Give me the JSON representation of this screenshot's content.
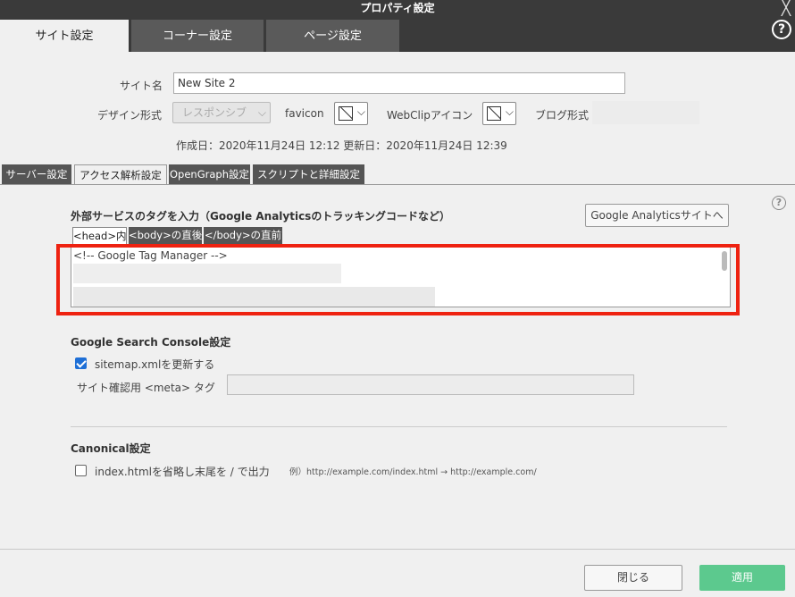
{
  "window": {
    "title": "プロパティ設定",
    "close_label": "╳"
  },
  "top_tabs": [
    {
      "label": "サイト設定"
    },
    {
      "label": "コーナー設定"
    },
    {
      "label": "ページ設定"
    }
  ],
  "site": {
    "name_label": "サイト名",
    "name_value": "New Site 2",
    "design_label": "デザイン形式",
    "design_value": "レスポンシブ",
    "favicon_label": "favicon",
    "webclip_label": "WebClipアイコン",
    "blog_label": "ブログ形式",
    "dates": "作成日：2020年11月24日 12:12 更新日：2020年11月24日 12:39"
  },
  "sub_tabs": [
    {
      "label": "サーバー設定"
    },
    {
      "label": "アクセス解析設定"
    },
    {
      "label": "OpenGraph設定"
    },
    {
      "label": "スクリプトと詳細設定"
    }
  ],
  "analytics": {
    "section_title": "外部サービスのタグを入力（Google Analyticsのトラッキングコードなど）",
    "ga_button": "Google Analyticsサイトへ",
    "tag_tabs": [
      {
        "label": "<head>内"
      },
      {
        "label": "<body>の直後"
      },
      {
        "label": "</body>の直前"
      }
    ],
    "textarea_line1": "<!-- Google Tag Manager -->"
  },
  "search_console": {
    "title": "Google Search Console設定",
    "sitemap_label": "sitemap.xmlを更新する",
    "sitemap_checked": true,
    "meta_label": "サイト確認用 <meta> タグ"
  },
  "canonical": {
    "title": "Canonical設定",
    "omit_label": "index.htmlを省略し末尾を / で出力",
    "omit_checked": false,
    "example": "例）http://example.com/index.html → http://example.com/"
  },
  "footer": {
    "close_button": "閉じる",
    "apply_button": "適用"
  },
  "colors": {
    "apply": "#5cc98e",
    "highlight": "#ee2211",
    "checkbox": "#1e6fd6"
  }
}
